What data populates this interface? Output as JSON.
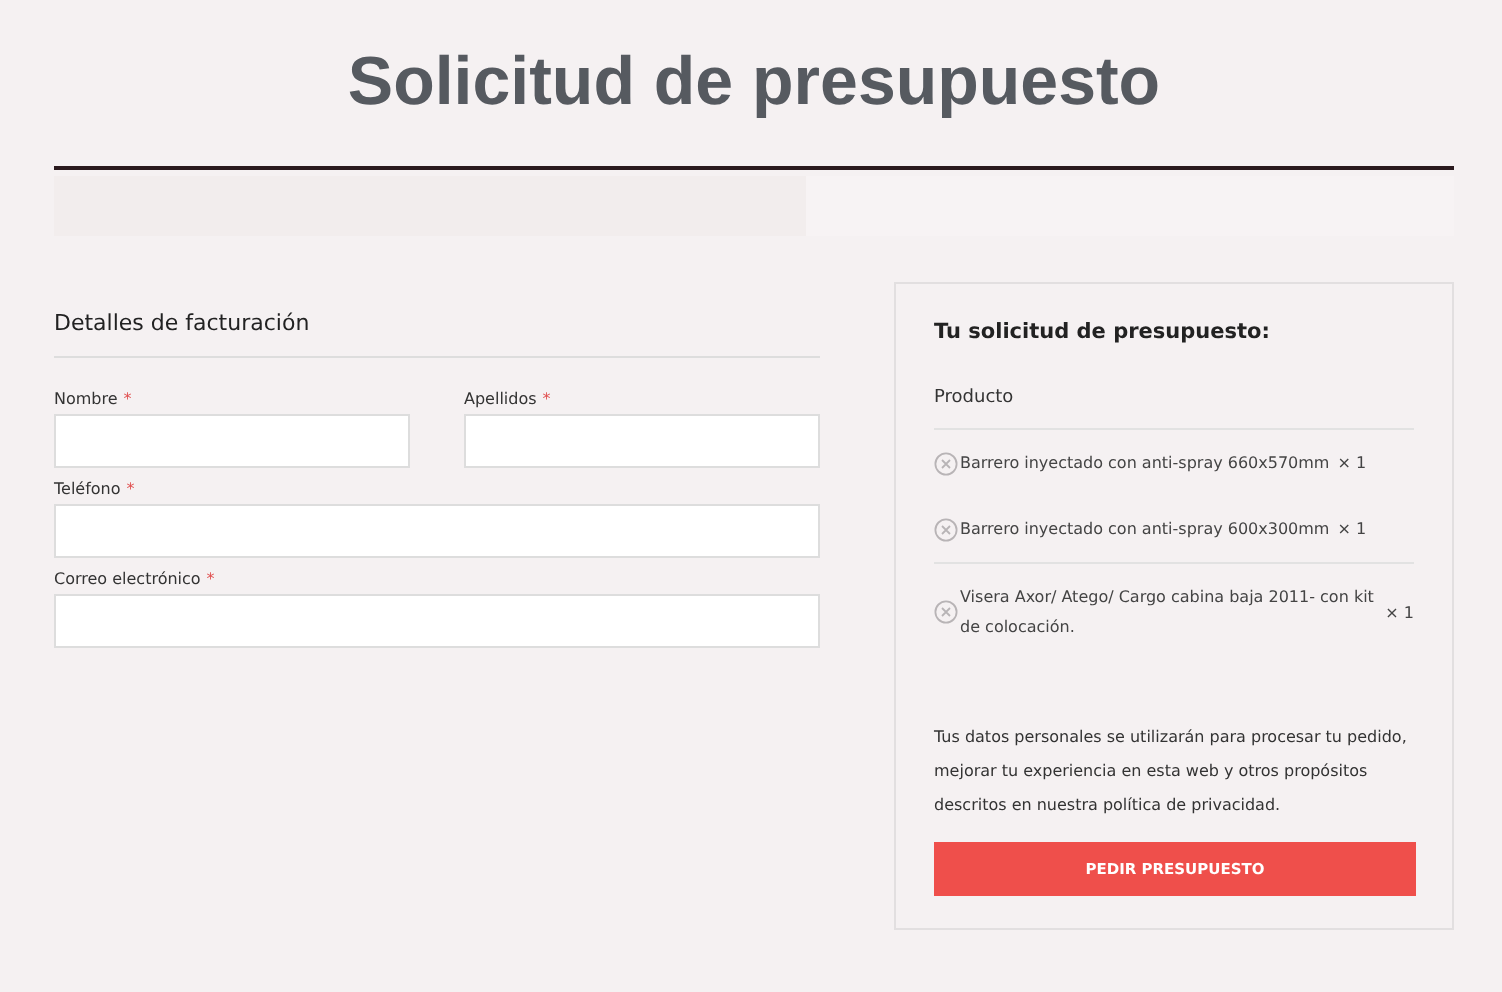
{
  "title": "Solicitud de presupuesto",
  "billing": {
    "heading": "Detalles de facturación",
    "fields": [
      {
        "label": "Nombre",
        "required_mark": "*",
        "kind": "half"
      },
      {
        "label": "Apellidos",
        "required_mark": "*",
        "kind": "half"
      },
      {
        "label": "Teléfono",
        "required_mark": "*",
        "kind": "full"
      },
      {
        "label": "Correo electrónico",
        "required_mark": "*",
        "kind": "full"
      }
    ]
  },
  "request": {
    "heading": "Tu solicitud de presupuesto:",
    "column": "Producto",
    "items": [
      {
        "name": "Barrero inyectado con anti-spray 660x570mm",
        "quantity": "× 1"
      },
      {
        "name": "Barrero inyectado con anti-spray 600x300mm",
        "quantity": "× 1"
      },
      {
        "name": "Visera Axor/ Atego/ Cargo cabina baja 2011- con kit de colocación.",
        "quantity": "× 1"
      }
    ],
    "privacy": "Tus datos personales se utilizarán para procesar tu pedido, mejorar tu experiencia en esta web y otros propósitos descritos en nuestra política de privacidad.",
    "button": "PEDIR PRESUPUESTO"
  }
}
